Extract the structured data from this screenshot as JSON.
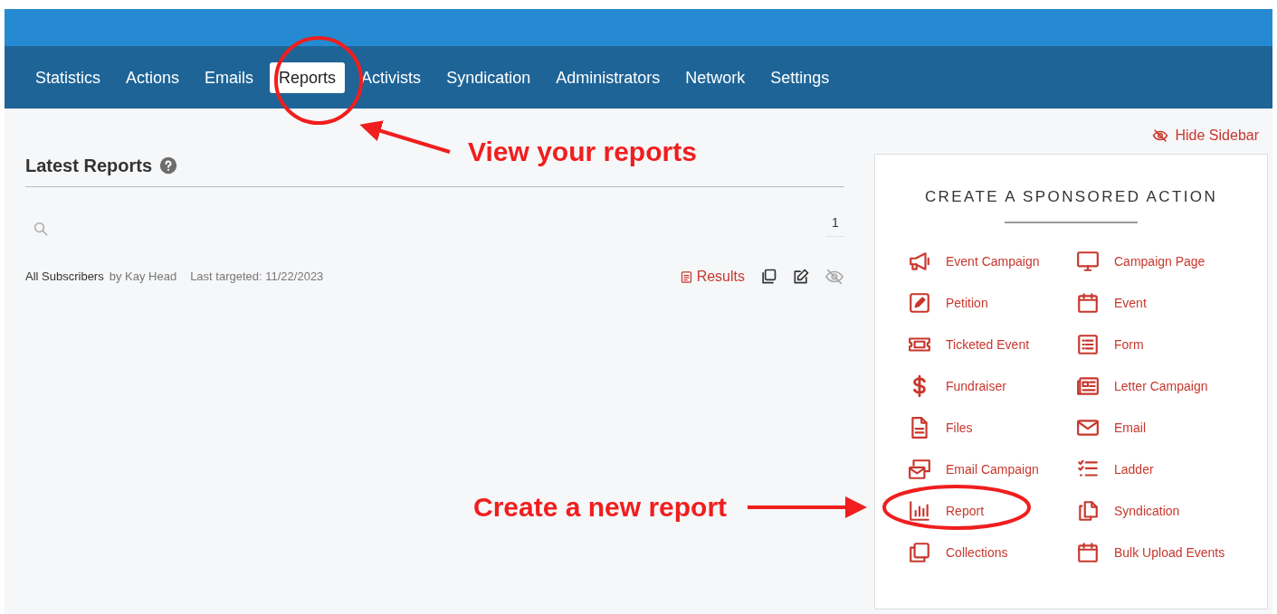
{
  "nav": {
    "tabs": [
      {
        "label": "Statistics",
        "selected": false
      },
      {
        "label": "Actions",
        "selected": false
      },
      {
        "label": "Emails",
        "selected": false
      },
      {
        "label": "Reports",
        "selected": true
      },
      {
        "label": "Activists",
        "selected": false
      },
      {
        "label": "Syndication",
        "selected": false
      },
      {
        "label": "Administrators",
        "selected": false
      },
      {
        "label": "Network",
        "selected": false
      },
      {
        "label": "Settings",
        "selected": false
      }
    ]
  },
  "latest_reports": {
    "title": "Latest Reports",
    "page": "1",
    "reports": [
      {
        "name": "All Subscribers",
        "author": "by Kay Head",
        "last_targeted": "Last targeted: 11/22/2023",
        "results_label": "Results"
      }
    ]
  },
  "sidebar": {
    "hide_label": "Hide Sidebar",
    "title": "CREATE A SPONSORED ACTION",
    "actions": [
      {
        "label": "Event Campaign"
      },
      {
        "label": "Campaign Page"
      },
      {
        "label": "Petition"
      },
      {
        "label": "Event"
      },
      {
        "label": "Ticketed Event"
      },
      {
        "label": "Form"
      },
      {
        "label": "Fundraiser"
      },
      {
        "label": "Letter Campaign"
      },
      {
        "label": "Files"
      },
      {
        "label": "Email"
      },
      {
        "label": "Email Campaign"
      },
      {
        "label": "Ladder"
      },
      {
        "label": "Report"
      },
      {
        "label": "Syndication"
      },
      {
        "label": "Collections"
      },
      {
        "label": "Bulk Upload Events"
      }
    ]
  },
  "annotations": [
    {
      "text": "View your reports"
    },
    {
      "text": "Create a new report"
    }
  ]
}
